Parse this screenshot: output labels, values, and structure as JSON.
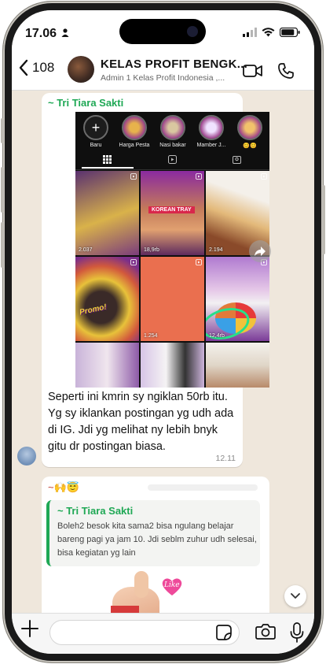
{
  "status_bar": {
    "time": "17.06"
  },
  "header": {
    "back_count": "108",
    "group_title": "KELAS PROFIT BENGK...",
    "group_subtitle": "Admin 1 Kelas Profit Indonesia ,..."
  },
  "instagram_preview": {
    "highlights": [
      {
        "label": "Baru"
      },
      {
        "label": "Harga Pesta"
      },
      {
        "label": "Nasi bakar"
      },
      {
        "label": "Mamber J..."
      },
      {
        "label": "😊😊"
      }
    ],
    "tile_texts": {
      "korean_tray": "KOREAN TRAY",
      "promo": "Promo!"
    },
    "view_counts": [
      "2.037",
      "18,9rb",
      "2.194",
      "1.254",
      "12,4rb"
    ]
  },
  "message1": {
    "sender": "~ Tri Tiara Sakti",
    "text": "Seperti ini kmrin sy ngiklan 50rb itu. Yg sy iklankan postingan yg udh ada di IG. Jdi yg melihat ny lebih bnyk gitu dr postingan biasa.",
    "time": "12.11"
  },
  "message2": {
    "sender": "~🙌😇",
    "quoted_sender": "~ Tri Tiara Sakti",
    "quoted_text": "Boleh2 besok kita sama2 bisa ngulang belajar bareng pagi ya jam 10. Jdi seblm zuhur udh selesai, bisa kegiatan yg lain",
    "sticker_text": "Like"
  },
  "colors": {
    "accent_green": "#1fa855",
    "chat_background": "#efe7dc"
  }
}
